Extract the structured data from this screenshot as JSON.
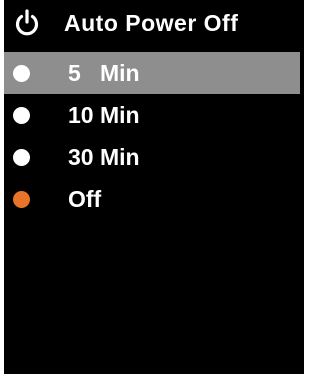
{
  "header": {
    "title": "Auto Power Off",
    "icon": "power-icon"
  },
  "menu": {
    "items": [
      {
        "label": "5   Min",
        "selected": true,
        "bullet_color": "#ffffff"
      },
      {
        "label": "10 Min",
        "selected": false,
        "bullet_color": "#ffffff"
      },
      {
        "label": "30 Min",
        "selected": false,
        "bullet_color": "#ffffff"
      },
      {
        "label": "Off",
        "selected": false,
        "bullet_color": "#e8732a",
        "current": true
      }
    ]
  },
  "colors": {
    "background": "#000000",
    "highlight": "#8e8e8e",
    "text": "#ffffff",
    "accent": "#e8732a"
  }
}
